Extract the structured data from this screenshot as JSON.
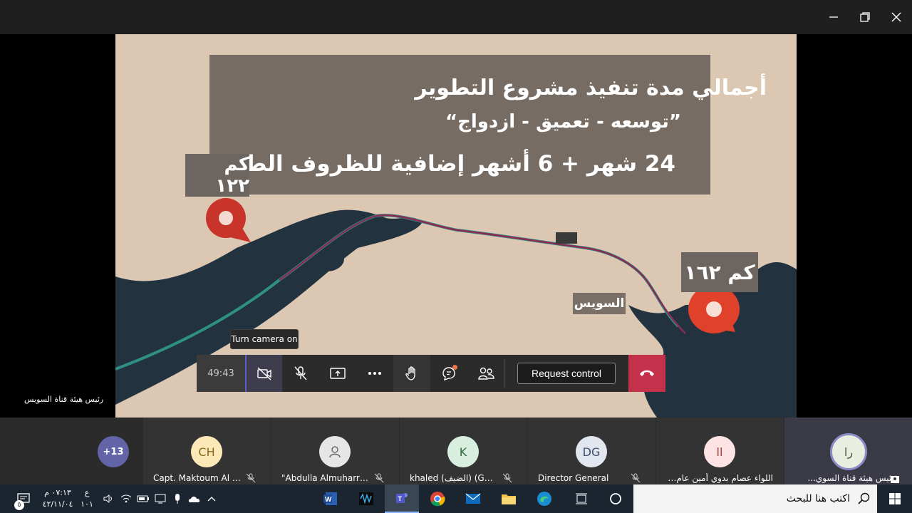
{
  "window": {
    "controls": [
      "minimize-icon",
      "restore-icon",
      "close-icon"
    ]
  },
  "slide": {
    "line1": "أجمالي مدة تنفيذ مشروع التطوير",
    "line2": "”توسعه - تعميق - ازدواج“",
    "line3": "24 شهر + 6 أشهر إضافية للظروف الطارئة",
    "km_left": "كم ١٢٢",
    "km_right": "كم ١٦٢",
    "city": "السويس",
    "banner_color": "#776c63",
    "pin_color": "#e0412a"
  },
  "presenter": {
    "name": "رئيس هيئة قناة السويس"
  },
  "tooltip": {
    "text": "Turn camera on"
  },
  "controls": {
    "timer": "49:43",
    "request_control": "Request control",
    "hangup_color": "#c4314b"
  },
  "participants": {
    "more_count": "+13",
    "tiles": [
      {
        "initials": "CH",
        "name": "Capt. Maktoum Al H...",
        "avatar_color": "#fde9b7"
      },
      {
        "initials": "",
        "name": "\"Abdulla Almuharra...",
        "avatar_color": "#e6e6e6"
      },
      {
        "initials": "K",
        "name": "khaled (الضيف) (Guest)",
        "avatar_color": "#d8efdf"
      },
      {
        "initials": "DG",
        "name": "Director General",
        "avatar_color": "#e1e6ef"
      },
      {
        "initials": "اا",
        "name": "اللواء عصام بدوي أمين عام ال...",
        "avatar_color": "#fde3e3"
      },
      {
        "initials": "را",
        "name": "رئيس هيئة قناة السوي...",
        "avatar_color": "#e8efe0"
      }
    ]
  },
  "taskbar": {
    "search_placeholder": "اكتب هنا للبحث",
    "time": "٠٧:١٣ م",
    "date": "٤٢/١١/٠٤",
    "lang_top": "ع",
    "lang_bottom": "١٠١",
    "notification_count": "٥"
  }
}
